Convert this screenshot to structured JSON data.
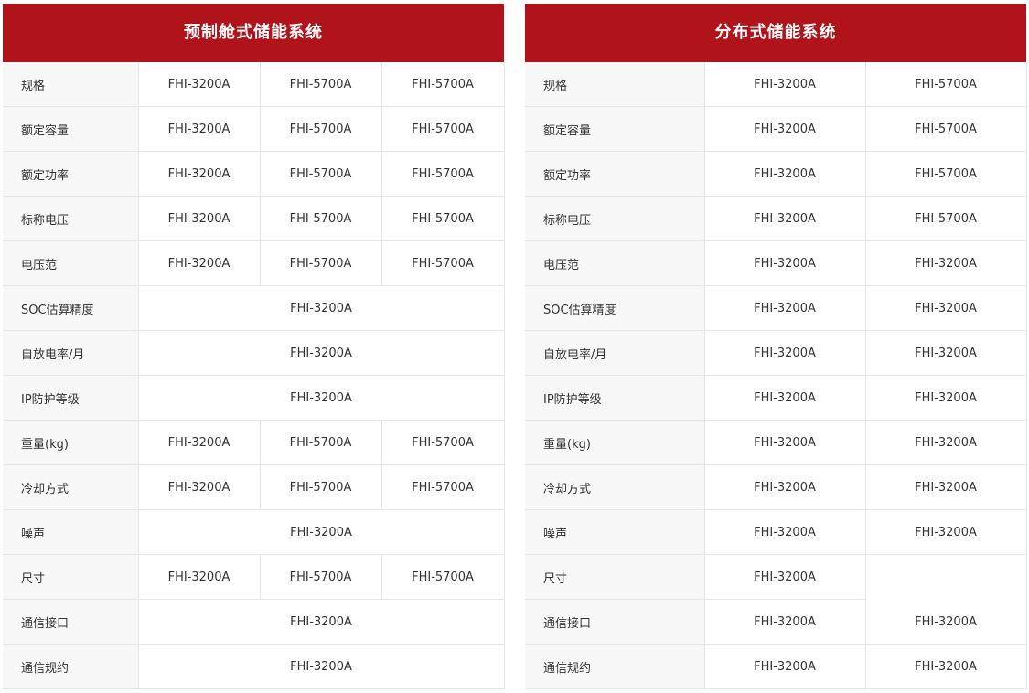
{
  "colors": {
    "header_bg": "#b0131a",
    "label_bg": "#f7f7f7",
    "border": "#e6e6e6"
  },
  "left": {
    "title": "预制舱式储能系统",
    "rows": [
      {
        "label": "规格",
        "cells": [
          {
            "text": "FHI-3200A"
          },
          {
            "text": "FHI-5700A"
          },
          {
            "text": "FHI-5700A"
          }
        ]
      },
      {
        "label": "额定容量",
        "cells": [
          {
            "text": "FHI-3200A"
          },
          {
            "text": "FHI-5700A"
          },
          {
            "text": "FHI-5700A"
          }
        ]
      },
      {
        "label": "额定功率",
        "cells": [
          {
            "text": "FHI-3200A"
          },
          {
            "text": "FHI-5700A"
          },
          {
            "text": "FHI-5700A"
          }
        ]
      },
      {
        "label": "标称电压",
        "cells": [
          {
            "text": "FHI-3200A"
          },
          {
            "text": "FHI-5700A"
          },
          {
            "text": "FHI-5700A"
          }
        ]
      },
      {
        "label": "电压范",
        "cells": [
          {
            "text": "FHI-3200A"
          },
          {
            "text": "FHI-5700A"
          },
          {
            "text": "FHI-5700A"
          }
        ]
      },
      {
        "label": "SOC估算精度",
        "cells": [
          {
            "text": "FHI-3200A",
            "span": 3
          }
        ]
      },
      {
        "label": "自放电率/月",
        "cells": [
          {
            "text": "FHI-3200A",
            "span": 3
          }
        ]
      },
      {
        "label": "IP防护等级",
        "cells": [
          {
            "text": "FHI-3200A",
            "span": 3
          }
        ]
      },
      {
        "label": "重量(kg)",
        "cells": [
          {
            "text": "FHI-3200A"
          },
          {
            "text": "FHI-5700A"
          },
          {
            "text": "FHI-5700A"
          }
        ]
      },
      {
        "label": "冷却方式",
        "cells": [
          {
            "text": "FHI-3200A"
          },
          {
            "text": "FHI-5700A"
          },
          {
            "text": "FHI-5700A"
          }
        ]
      },
      {
        "label": "噪声",
        "cells": [
          {
            "text": "FHI-3200A",
            "span": 3
          }
        ]
      },
      {
        "label": "尺寸",
        "cells": [
          {
            "text": "FHI-3200A"
          },
          {
            "text": "FHI-5700A"
          },
          {
            "text": "FHI-5700A"
          }
        ]
      },
      {
        "label": "通信接口",
        "cells": [
          {
            "text": "FHI-3200A",
            "span": 3
          }
        ]
      },
      {
        "label": "通信规约",
        "cells": [
          {
            "text": "FHI-3200A",
            "span": 3
          }
        ]
      }
    ]
  },
  "right": {
    "title": "分布式储能系统",
    "rows": [
      {
        "label": "规格",
        "cells": [
          {
            "text": "FHI-3200A"
          },
          {
            "text": "FHI-5700A"
          }
        ]
      },
      {
        "label": "额定容量",
        "cells": [
          {
            "text": "FHI-3200A"
          },
          {
            "text": "FHI-5700A"
          }
        ]
      },
      {
        "label": "额定功率",
        "cells": [
          {
            "text": "FHI-3200A"
          },
          {
            "text": "FHI-5700A"
          }
        ]
      },
      {
        "label": "标称电压",
        "cells": [
          {
            "text": "FHI-3200A"
          },
          {
            "text": "FHI-5700A"
          }
        ]
      },
      {
        "label": "电压范",
        "cells": [
          {
            "text": "FHI-3200A"
          },
          {
            "text": "FHI-3200A"
          }
        ]
      },
      {
        "label": "SOC估算精度",
        "cells": [
          {
            "text": "FHI-3200A"
          },
          {
            "text": "FHI-3200A"
          }
        ]
      },
      {
        "label": "自放电率/月",
        "cells": [
          {
            "text": "FHI-3200A"
          },
          {
            "text": "FHI-3200A"
          }
        ]
      },
      {
        "label": "IP防护等级",
        "cells": [
          {
            "text": "FHI-3200A"
          },
          {
            "text": "FHI-3200A"
          }
        ]
      },
      {
        "label": "重量(kg)",
        "cells": [
          {
            "text": "FHI-3200A"
          },
          {
            "text": "FHI-3200A"
          }
        ]
      },
      {
        "label": "冷却方式",
        "cells": [
          {
            "text": "FHI-3200A"
          },
          {
            "text": "FHI-3200A"
          }
        ]
      },
      {
        "label": "噪声",
        "cells": [
          {
            "text": "FHI-3200A"
          },
          {
            "text": "FHI-3200A"
          }
        ]
      },
      {
        "label": "尺寸",
        "cells": [
          {
            "text": "FHI-3200A"
          },
          {
            "text": "",
            "empty": true
          }
        ]
      },
      {
        "label": "通信接口",
        "cells": [
          {
            "text": "FHI-3200A"
          },
          {
            "text": "FHI-3200A"
          }
        ]
      },
      {
        "label": "通信规约",
        "cells": [
          {
            "text": "FHI-3200A"
          },
          {
            "text": "FHI-3200A"
          }
        ]
      }
    ]
  }
}
